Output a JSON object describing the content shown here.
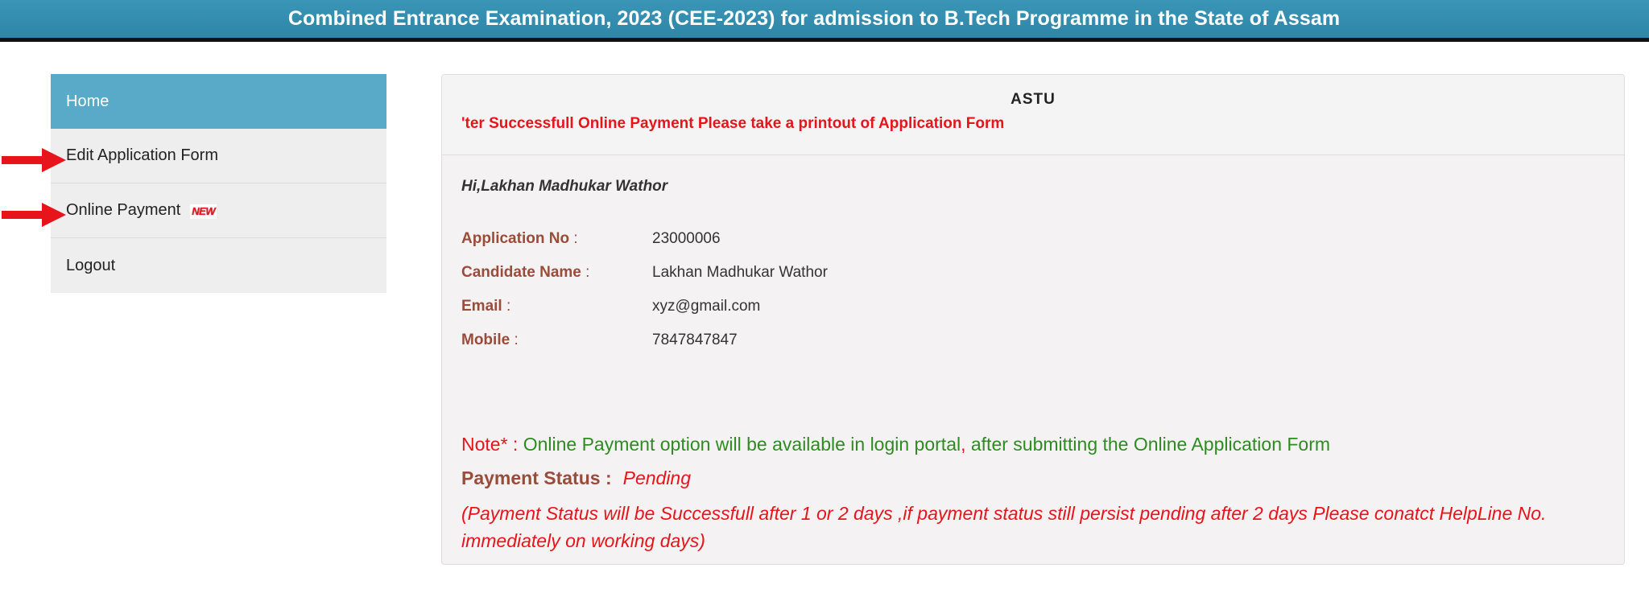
{
  "header": {
    "title": "Combined Entrance Examination, 2023 (CEE-2023) for admission to B.Tech Programme in the State of Assam"
  },
  "sidebar": {
    "items": [
      {
        "label": "Home",
        "active": true
      },
      {
        "label": "Edit Application Form"
      },
      {
        "label": "Online Payment",
        "badge": "NEW"
      },
      {
        "label": "Logout"
      }
    ]
  },
  "panel": {
    "org": "ASTU",
    "marquee": "'ter Successfull Online Payment Please take a printout of Application Form",
    "greeting": "Hi,Lakhan Madhukar Wathor",
    "details": [
      {
        "label": "Application No",
        "sep": " :",
        "value": "23000006"
      },
      {
        "label": "Candidate Name",
        "sep": " :",
        "value": "Lakhan Madhukar Wathor"
      },
      {
        "label": "Email",
        "sep": " :",
        "value": "xyz@gmail.com"
      },
      {
        "label": "Mobile",
        "sep": " :",
        "value": "7847847847"
      }
    ],
    "note": {
      "prefix": "Note* :",
      "text": " Online Payment option will be available in login portal",
      "comma": ",",
      "text2": " after submitting the Online Application Form"
    },
    "payment_status": {
      "label": "Payment Status :",
      "value": "Pending"
    },
    "payment_info": "(Payment Status will be Successfull after 1 or 2 days ,if payment status still persist pending after 2 days Please conatct HelpLine No. immediately on working days)"
  },
  "colors": {
    "header_bg": "#2e86a8",
    "active_menu": "#59a9c8",
    "label_brown": "#9a4c3a",
    "alert_red": "#e8141b",
    "note_green": "#2e8b22"
  }
}
